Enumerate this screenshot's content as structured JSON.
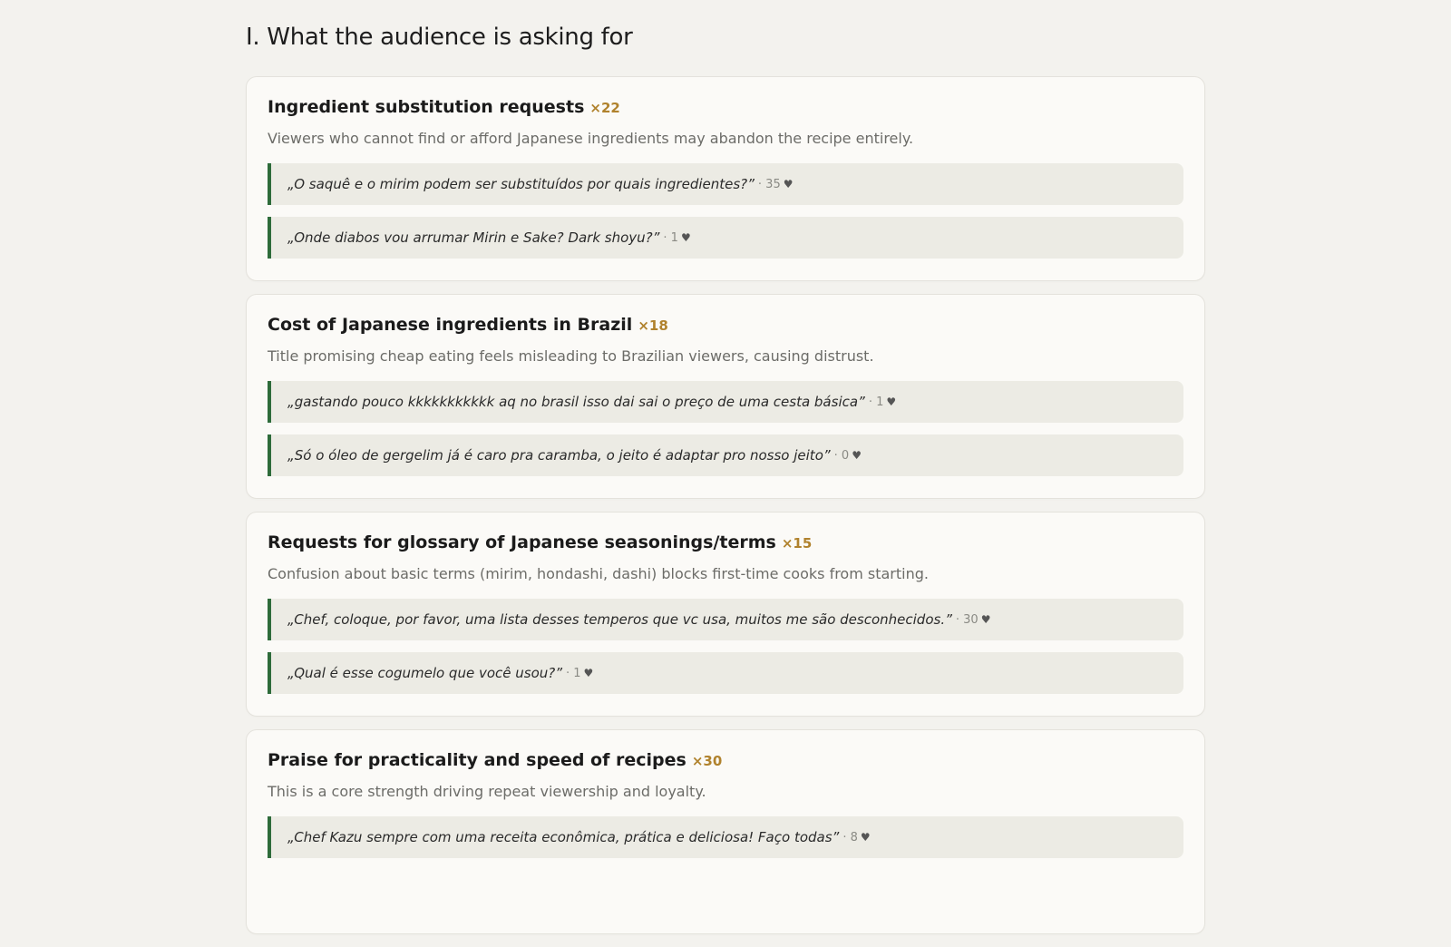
{
  "section": {
    "title": "I. What the audience is asking for"
  },
  "cards": [
    {
      "title": "Ingredient substitution requests",
      "count": "×22",
      "description": "Viewers who cannot find or afford Japanese ingredients may abandon the recipe entirely.",
      "quotes": [
        {
          "text": "„O saquê e o mirim podem ser substituídos por quais ingredientes?”",
          "likes": "· 35",
          "heart": "♥"
        },
        {
          "text": "„Onde diabos vou arrumar Mirin e Sake? Dark shoyu?”",
          "likes": "· 1",
          "heart": "♥"
        }
      ]
    },
    {
      "title": "Cost of Japanese ingredients in Brazil",
      "count": "×18",
      "description": "Title promising cheap eating feels misleading to Brazilian viewers, causing distrust.",
      "quotes": [
        {
          "text": "„gastando pouco kkkkkkkkkkk aq no brasil isso dai sai o preço de uma cesta básica”",
          "likes": "· 1",
          "heart": "♥"
        },
        {
          "text": "„Só o óleo de gergelim já é caro pra caramba, o jeito é adaptar pro nosso jeito”",
          "likes": "· 0",
          "heart": "♥"
        }
      ]
    },
    {
      "title": "Requests for glossary of Japanese seasonings/terms",
      "count": "×15",
      "description": "Confusion about basic terms (mirim, hondashi, dashi) blocks first-time cooks from starting.",
      "quotes": [
        {
          "text": "„Chef, coloque, por favor, uma lista desses temperos que vc usa, muitos me são desconhecidos.”",
          "likes": "· 30",
          "heart": "♥"
        },
        {
          "text": "„Qual é esse cogumelo que você usou?”",
          "likes": "· 1",
          "heart": "♥"
        }
      ]
    },
    {
      "title": "Praise for practicality and speed of recipes",
      "count": "×30",
      "description": "This is a core strength driving repeat viewership and loyalty.",
      "quotes": [
        {
          "text": "„Chef Kazu sempre com uma receita econômica, prática e deliciosa! Faço todas”",
          "likes": "· 8",
          "heart": "♥"
        }
      ]
    }
  ]
}
